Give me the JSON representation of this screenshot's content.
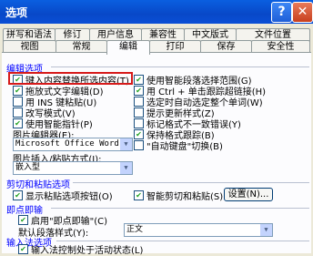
{
  "window": {
    "title": "选项",
    "help": "?",
    "close": "✕"
  },
  "tabs_row1": [
    "拼写和语法",
    "修订",
    "用户信息",
    "兼容性",
    "中文版式",
    "文件位置"
  ],
  "tabs_row2": [
    "视图",
    "常规",
    "编辑",
    "打印",
    "保存",
    "安全性"
  ],
  "active_tab": "编辑",
  "edit": {
    "section": "编辑选项",
    "left": [
      {
        "label": "键入内容替换所选内容(T)",
        "checked": true
      },
      {
        "label": "拖放式文字编辑(D)",
        "checked": true
      },
      {
        "label": "用 INS 键粘贴(U)",
        "checked": false
      },
      {
        "label": "改写模式(V)",
        "checked": false
      },
      {
        "label": "使用智能指针(P)",
        "checked": true
      }
    ],
    "right": [
      {
        "label": "使用智能段落选择范围(G)",
        "checked": true
      },
      {
        "label": "用 Ctrl + 单击跟踪超链接(H)",
        "checked": true
      },
      {
        "label": "选定时自动选定整个单词(W)",
        "checked": false
      },
      {
        "label": "提示更新样式(Z)",
        "checked": false
      },
      {
        "label": "标记格式不一致错误(Y)",
        "checked": false
      },
      {
        "label": "保持格式跟踪(B)",
        "checked": true
      },
      {
        "label": "\"自动键盘\"切换(B)",
        "checked": false
      }
    ],
    "picture_editor_label": "图片编辑器(E):",
    "picture_editor_value": "Microsoft Office Word",
    "paste_as_label": "图片插入/粘贴方式(I):",
    "paste_as_value": "嵌入型"
  },
  "cutpaste": {
    "section": "剪切和粘贴选项",
    "show_paste_buttons": {
      "label": "显示粘贴选项按钮(O)",
      "checked": true
    },
    "smart_cut": {
      "label": "智能剪切和粘贴(S)",
      "checked": true
    },
    "settings_button": "设置(N)..."
  },
  "clicktype": {
    "section": "即点即输",
    "enable": {
      "label": "启用\"即点即输\"(C)",
      "checked": true
    },
    "default_style_label": "默认段落样式(Y):",
    "default_style_value": "正文"
  },
  "ime": {
    "section": "输入法选项",
    "ime_state": {
      "label": "输入法控制处于活动状态(L)",
      "checked": true
    }
  }
}
